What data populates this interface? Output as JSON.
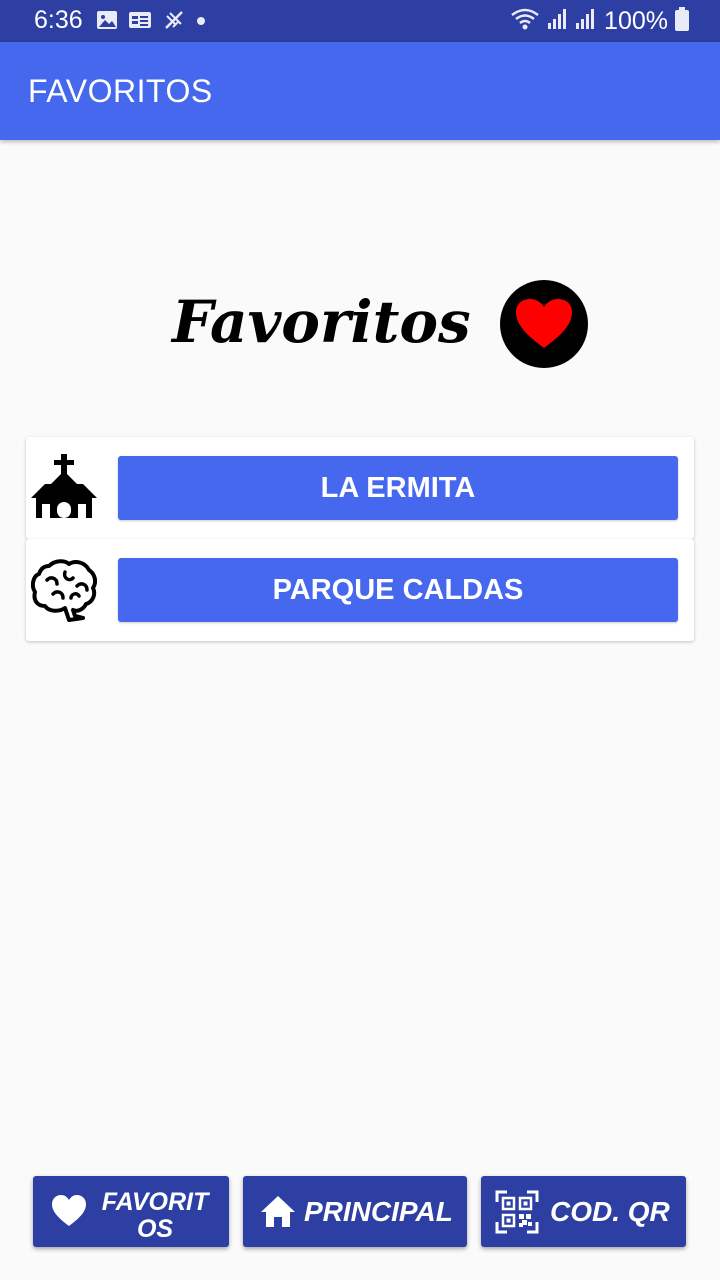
{
  "status_bar": {
    "time": "6:36",
    "battery": "100%",
    "icons_left": [
      "image-icon",
      "news-icon",
      "signal-off-icon",
      "dot-icon"
    ],
    "icons_right": [
      "wifi-icon",
      "signal-icon",
      "signal-icon",
      "battery-icon"
    ]
  },
  "app_bar": {
    "title": "FAVORITOS"
  },
  "main": {
    "heading": "Favoritos",
    "heading_icon": "heart-icon",
    "favorites": [
      {
        "icon": "church-icon",
        "label": "LA ERMITA"
      },
      {
        "icon": "brain-icon",
        "label": "PARQUE CALDAS"
      }
    ]
  },
  "bottom_nav": [
    {
      "icon": "heart-icon",
      "label": "FAVORITOS"
    },
    {
      "icon": "home-icon",
      "label": "PRINCIPAL"
    },
    {
      "icon": "qr-code-icon",
      "label": "COD. QR"
    }
  ],
  "colors": {
    "status_bar": "#2e3fa3",
    "app_bar": "#4568ee",
    "button": "#4568ee",
    "nav_button": "#2e3fa3",
    "heart": "#ff0000"
  }
}
